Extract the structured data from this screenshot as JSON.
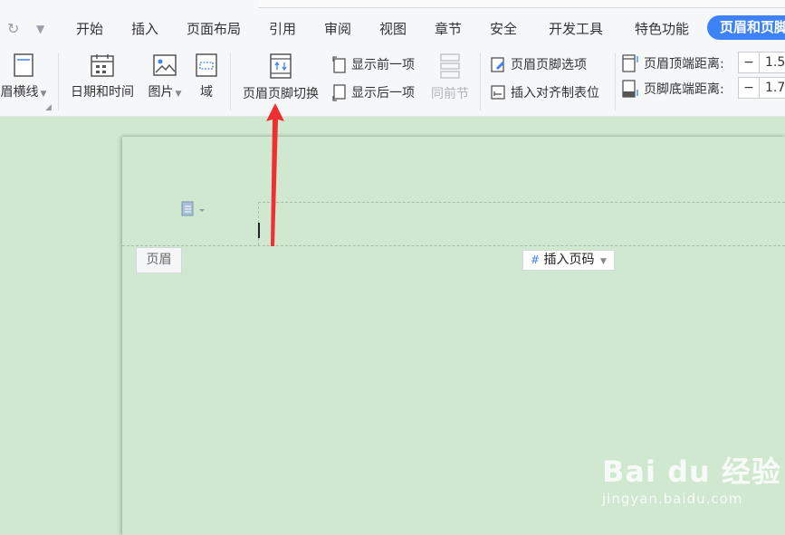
{
  "menu": {
    "tabs": [
      "开始",
      "插入",
      "页面布局",
      "引用",
      "审阅",
      "视图",
      "章节",
      "安全",
      "开发工具",
      "特色功能"
    ],
    "active_tab": "页眉和页脚"
  },
  "ribbon": {
    "header_line_label": "眉横线",
    "date_time_label": "日期和时间",
    "picture_label": "图片",
    "field_label": "域",
    "switch_label": "页眉页脚切换",
    "show_prev_label": "显示前一项",
    "show_next_label": "显示后一项",
    "same_as_prev_label": "同前节",
    "hf_options_label": "页眉页脚选项",
    "insert_tab_label": "插入对齐制表位",
    "header_top_label": "页眉顶端距离:",
    "footer_bottom_label": "页脚底端距离:",
    "header_top_value": "1.5",
    "footer_bottom_value": "1.7",
    "minus": "−"
  },
  "document": {
    "header_tag": "页眉",
    "insert_page_number": "插入页码"
  },
  "watermark": {
    "brand": "Bai du 经验",
    "url": "jingyan.baidu.com"
  },
  "colors": {
    "accent": "#3e82f7",
    "page_bg": "#cfe8cf",
    "arrow": "#f03030"
  }
}
